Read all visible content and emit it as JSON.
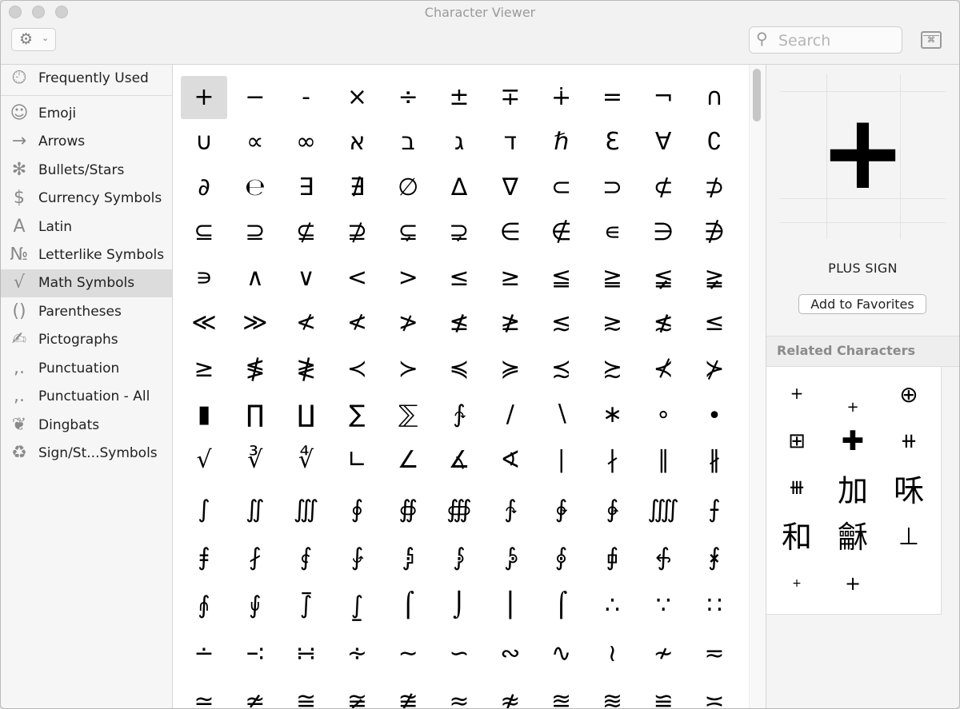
{
  "window": {
    "title": "Character Viewer"
  },
  "toolbar": {
    "gear_icon": "gear-icon",
    "search_placeholder": "Search",
    "search_icon": "magnifier-icon",
    "keyboard_viewer_icon": "keyboard-icon"
  },
  "sidebar": {
    "items": [
      {
        "label": "Frequently Used",
        "icon": "clock-icon",
        "glyph": "🕘︎"
      },
      {
        "label": "Emoji",
        "icon": "smiley-icon",
        "glyph": "☺"
      },
      {
        "label": "Arrows",
        "icon": "arrow-icon",
        "glyph": "→"
      },
      {
        "label": "Bullets/Stars",
        "icon": "asterisk-icon",
        "glyph": "✻"
      },
      {
        "label": "Currency Symbols",
        "icon": "dollar-icon",
        "glyph": "$"
      },
      {
        "label": "Latin",
        "icon": "latin-a-icon",
        "glyph": "A"
      },
      {
        "label": "Letterlike Symbols",
        "icon": "numero-icon",
        "glyph": "№"
      },
      {
        "label": "Math Symbols",
        "icon": "square-root-icon",
        "glyph": "√"
      },
      {
        "label": "Parentheses",
        "icon": "parentheses-icon",
        "glyph": "()"
      },
      {
        "label": "Pictographs",
        "icon": "pencil-hand-icon",
        "glyph": "✍"
      },
      {
        "label": "Punctuation",
        "icon": "comma-dot-icon",
        "glyph": ",."
      },
      {
        "label": "Punctuation - All",
        "icon": "comma-dot-icon",
        "glyph": ",."
      },
      {
        "label": "Dingbats",
        "icon": "heart-icon",
        "glyph": "❦"
      },
      {
        "label": "Sign/St...Symbols",
        "icon": "recycle-icon",
        "glyph": "♻"
      }
    ],
    "selected": "Math Symbols"
  },
  "grid": {
    "selected": "+",
    "rows": [
      [
        "+",
        "−",
        "-",
        "×",
        "÷",
        "±",
        "∓",
        "∔",
        "=",
        "¬",
        "∩"
      ],
      [
        "∪",
        "∝",
        "∞",
        "א",
        "ב",
        "ג",
        "ד",
        "ℏ",
        "Ɛ",
        "∀",
        "∁"
      ],
      [
        "∂",
        "℮",
        "∃",
        "∄",
        "∅",
        "∆",
        "∇",
        "⊂",
        "⊃",
        "⊄",
        "⊅"
      ],
      [
        "⊆",
        "⊇",
        "⊈",
        "⊉",
        "⊊",
        "⊋",
        "∈",
        "∉",
        "∊",
        "∋",
        "∌"
      ],
      [
        "∍",
        "∧",
        "∨",
        "<",
        ">",
        "≤",
        "≥",
        "≦",
        "≧",
        "≨",
        "≩"
      ],
      [
        "≪",
        "≫",
        "≮",
        "≮",
        "≯",
        "≰",
        "≱",
        "≲",
        "≳",
        "≴",
        "≤"
      ],
      [
        "≥",
        "≸",
        "≹",
        "≺",
        "≻",
        "≼",
        "≽",
        "≾",
        "≿",
        "⊀",
        "⊁"
      ],
      [
        "▮",
        "∏",
        "∐",
        "∑",
        "⅀",
        "∱",
        "∕",
        "∖",
        "∗",
        "∘",
        "∙"
      ],
      [
        "√",
        "∛",
        "∜",
        "∟",
        "∠",
        "∡",
        "∢",
        "∣",
        "∤",
        "∥",
        "∦"
      ],
      [
        "∫",
        "∬",
        "∭",
        "∮",
        "∯",
        "∰",
        "∱",
        "∲",
        "∳",
        "⨌",
        "⨍"
      ],
      [
        "⨎",
        "⨏",
        "⨐",
        "⨑",
        "⨒",
        "⨓",
        "⨔",
        "⨕",
        "⨖",
        "⨗",
        "⨘"
      ],
      [
        "⨙",
        "⨚",
        "⨛",
        "⨜",
        "⌠",
        "⌡",
        "⎮",
        "⌠",
        "∴",
        "∵",
        "∷"
      ],
      [
        "∸",
        "∹",
        "∺",
        "∻",
        "∼",
        "∽",
        "∾",
        "∿",
        "≀",
        "≁",
        "≂"
      ],
      [
        "≃",
        "≄",
        "≅",
        "≆",
        "≇",
        "≈",
        "≉",
        "≊",
        "≋",
        "≌",
        "≍"
      ]
    ]
  },
  "detail": {
    "character": "+",
    "name": "PLUS SIGN",
    "add_to_favorites_label": "Add to Favorites",
    "related_header": "Related Characters",
    "related": [
      "+",
      "+",
      "⊕",
      "⊞",
      "✚",
      "⧺",
      "⧻",
      "加",
      "咊",
      "和",
      "龢",
      "⊥",
      "+",
      "+"
    ]
  }
}
